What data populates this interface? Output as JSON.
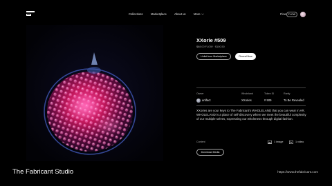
{
  "nav": {
    "links": [
      "Collections",
      "Marketplace",
      "About us",
      "More"
    ],
    "flow_label": "Flow",
    "flow_badge": "FLOW"
  },
  "nft": {
    "title": "XXorie #509",
    "price": "$88.00 FLOW · $100.50",
    "unlist_button": "Unlist from Marketplace",
    "reveal_button": "Reveal Now"
  },
  "meta": {
    "labels": [
      "Owner",
      "Wholeland",
      "Token ID",
      "Rarity"
    ],
    "owner": "artifact",
    "wholeland": "XXories",
    "token_id": "# 509",
    "rarity": "To Be Revealed"
  },
  "description": "XXories are your keys to The Fabricant's WHOLELAND that you can wear in AR. WHOLELAND is a place of self-discovery where we meet the beautiful complexity of our multiple selves, expressing our wholeness through digital fashion.",
  "content": {
    "label": "Content",
    "images": "1 image",
    "videos": "1 video",
    "download_button": "Download Media"
  },
  "footer": {
    "studio": "The Fabricant Studio",
    "url": "https://www.thefabricant.com"
  },
  "colors": {
    "background": "#000000",
    "accent": "#ff3c8c"
  }
}
